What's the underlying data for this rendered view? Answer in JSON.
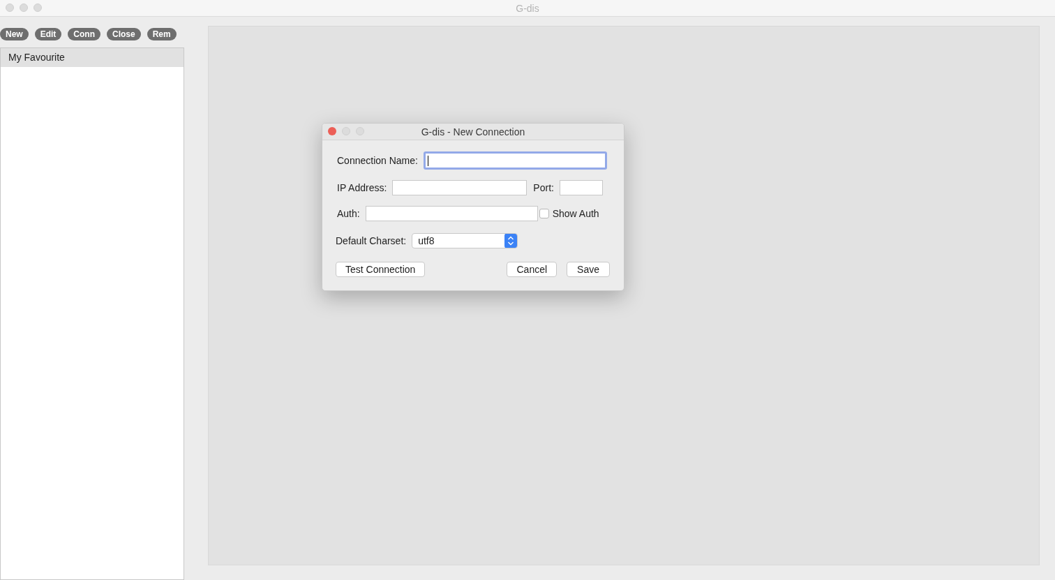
{
  "window": {
    "title": "G-dis"
  },
  "toolbar": [
    "New",
    "Edit",
    "Conn",
    "Close",
    "Rem"
  ],
  "sidebar": {
    "items": [
      {
        "label": "My Favourite",
        "selected": true
      }
    ]
  },
  "dialog": {
    "title": "G-dis - New Connection",
    "connection_name": {
      "label": "Connection Name:",
      "focused": true
    },
    "ip_address": {
      "label": "IP Address:",
      "focused": false
    },
    "port": {
      "label": "Port:",
      "focused": false
    },
    "auth": {
      "label": "Auth:",
      "focused": false
    },
    "show_auth": {
      "label": "Show Auth",
      "checked": false
    },
    "default_charset": {
      "label": "Default Charset:",
      "value": "utf8"
    },
    "buttons": [
      "Test Connection",
      "Cancel",
      "Save"
    ]
  }
}
